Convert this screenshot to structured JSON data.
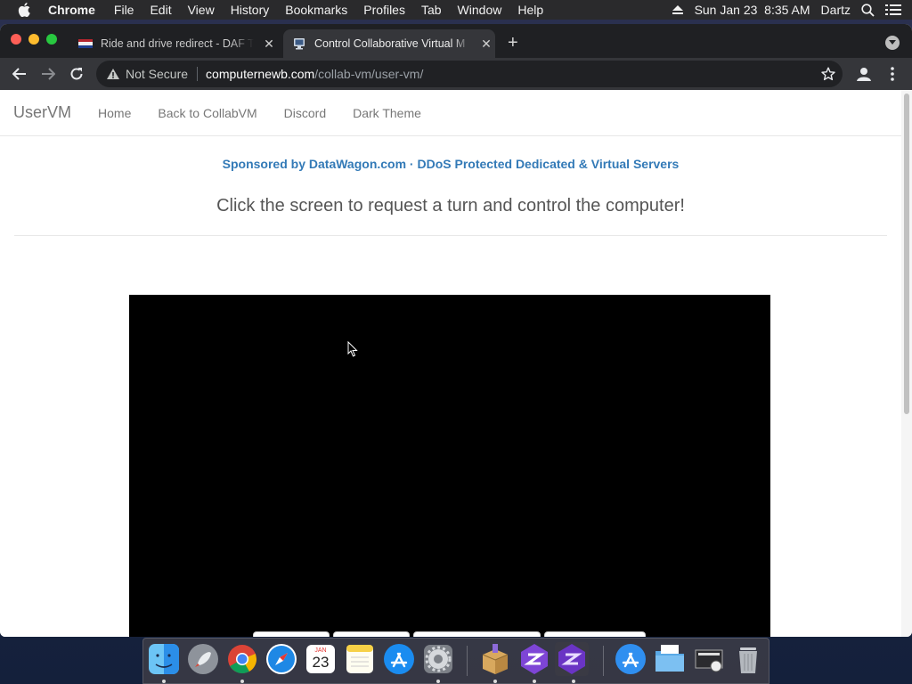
{
  "menubar": {
    "app_name": "Chrome",
    "items": [
      "File",
      "Edit",
      "View",
      "History",
      "Bookmarks",
      "Profiles",
      "Tab",
      "Window",
      "Help"
    ],
    "datetime": "Sun Jan 23  8:35 AM",
    "user": "Dartz"
  },
  "browser": {
    "tabs": [
      {
        "title": "Ride and drive redirect - DAF T",
        "active": false
      },
      {
        "title": "Control Collaborative Virtual M",
        "active": true
      }
    ],
    "address": {
      "security_label": "Not Secure",
      "host": "computernewb.com",
      "path": "/collab-vm/user-vm/"
    }
  },
  "page": {
    "brand": "UserVM",
    "nav": [
      "Home",
      "Back to CollabVM",
      "Discord",
      "Dark Theme"
    ],
    "sponsor": "Sponsored by DataWagon.com · DDoS Protected Dedicated & Virtual Servers",
    "headline": "Click the screen to request a turn and control the computer!"
  },
  "dock": {
    "calendar": {
      "month": "JAN",
      "day": "23"
    }
  },
  "colors": {
    "link": "#337ab7",
    "menubar_bg": "#2a2a2c",
    "tab_bg": "#1f2023",
    "toolbar_bg": "#35363a",
    "vm_screen": "#000000"
  }
}
